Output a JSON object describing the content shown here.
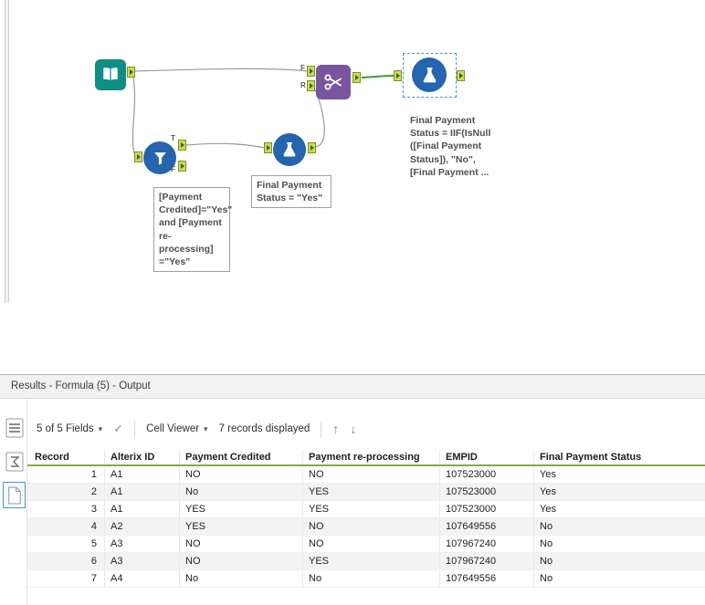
{
  "canvas": {
    "anchor_labels": {
      "filter_true": "T",
      "filter_false": "F",
      "join_top": "F",
      "join_bottom": "R"
    },
    "annotations": {
      "filter": "[Payment\nCredited]=\"Yes\"\nand [Payment re-\nprocessing]\n=\"Yes\"",
      "formula1": "Final Payment\nStatus = \"Yes\"",
      "formula2": "Final Payment\nStatus = IIF(IsNull\n([Final Payment\nStatus]), \"No\",\n[Final Payment ..."
    }
  },
  "results": {
    "title": "Results - Formula (5) - Output",
    "toolbar": {
      "fields": "5 of 5 Fields",
      "cell_viewer": "Cell Viewer",
      "records": "7 records displayed"
    },
    "table": {
      "columns": [
        "Record",
        "Alterix ID",
        "Payment Credited",
        "Payment re-processing",
        "EMPID",
        "Final Payment Status"
      ],
      "rows": [
        [
          "1",
          "A1",
          "NO",
          "NO",
          "107523000",
          "Yes"
        ],
        [
          "2",
          "A1",
          "No",
          "YES",
          "107523000",
          "Yes"
        ],
        [
          "3",
          "A1",
          "YES",
          "YES",
          "107523000",
          "Yes"
        ],
        [
          "4",
          "A2",
          "YES",
          "NO",
          "107649556",
          "No"
        ],
        [
          "5",
          "A3",
          "NO",
          "NO",
          "107967240",
          "No"
        ],
        [
          "6",
          "A3",
          "NO",
          "YES",
          "107967240",
          "No"
        ],
        [
          "7",
          "A4",
          "No",
          "No",
          "107649556",
          "No"
        ]
      ]
    }
  },
  "icons": {
    "caret_down": "▾",
    "checkmark": "✓",
    "arrow_up": "↑",
    "arrow_down": "↓",
    "grip": "·····"
  },
  "colors": {
    "tool_blue": "#2565ad",
    "tool_teal": "#0f8e85",
    "tool_purple": "#7a549e",
    "anchor_green": "#cbdc5a",
    "selected_wire": "#3c9b35",
    "header_underline": "#7fae3f"
  }
}
